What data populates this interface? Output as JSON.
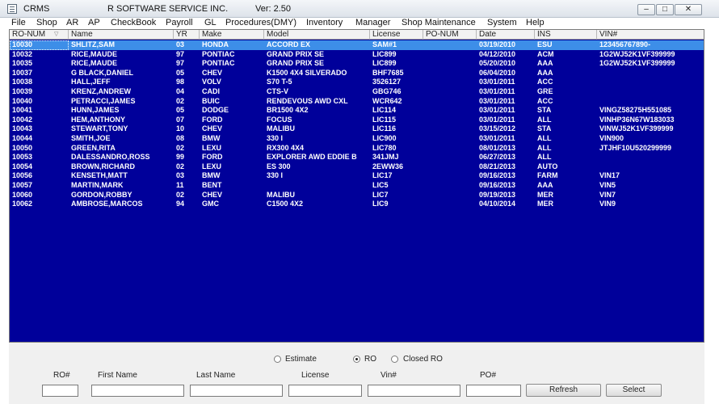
{
  "titlebar": {
    "app_name": "CRMS",
    "company": "R SOFTWARE SERVICE INC.",
    "version": "Ver: 2.50",
    "minimize": "–",
    "maximize": "□",
    "close": "✕"
  },
  "menu": [
    "File",
    "Shop",
    "AR",
    "AP",
    "CheckBook",
    "Payroll",
    "GL",
    "Procedures(DMY)",
    "Inventory",
    "Manager",
    "Shop Maintenance",
    "System",
    "Help"
  ],
  "grid": {
    "columns": [
      "RO-NUM",
      "Name",
      "YR",
      "Make",
      "Model",
      "License",
      "PO-NUM",
      "Date",
      "INS",
      "VIN#"
    ],
    "selected_index": 0,
    "rows": [
      [
        "10030",
        "SHLITZ,SAM",
        "03",
        "HONDA",
        "ACCORD EX",
        "SAM#1",
        "",
        "03/19/2010",
        "ESU",
        "123456767890-"
      ],
      [
        "10032",
        "RICE,MAUDE",
        "97",
        "PONTIAC",
        "GRAND PRIX SE",
        "LIC899",
        "",
        "04/12/2010",
        "ACM",
        "1G2WJ52K1VF399999"
      ],
      [
        "10035",
        "RICE,MAUDE",
        "97",
        "PONTIAC",
        "GRAND PRIX SE",
        "LIC899",
        "",
        "05/20/2010",
        "AAA",
        "1G2WJ52K1VF399999"
      ],
      [
        "10037",
        "G BLACK,DANIEL",
        "05",
        "CHEV",
        "K1500 4X4 SILVERADO",
        "BHF7685",
        "",
        "06/04/2010",
        "AAA",
        ""
      ],
      [
        "10038",
        "HALL,JEFF",
        "98",
        "VOLV",
        "S70 T-5",
        "3526127",
        "",
        "03/01/2011",
        "ACC",
        ""
      ],
      [
        "10039",
        "KRENZ,ANDREW",
        "04",
        "CADI",
        "CTS-V",
        "GBG746",
        "",
        "03/01/2011",
        "GRE",
        ""
      ],
      [
        "10040",
        "PETRACCI,JAMES",
        "02",
        "BUIC",
        "RENDEVOUS AWD CXL",
        "WCR642",
        "",
        "03/01/2011",
        "ACC",
        ""
      ],
      [
        "10041",
        "HUNN,JAMES",
        "05",
        "DODGE",
        "BR1500 4X2",
        "LIC114",
        "",
        "03/01/2011",
        "STA",
        "VINGZ58275H551085"
      ],
      [
        "10042",
        "HEM,ANTHONY",
        "07",
        "FORD",
        "FOCUS",
        "LIC115",
        "",
        "03/01/2011",
        "ALL",
        "VINHP36N67W183033"
      ],
      [
        "10043",
        "STEWART,TONY",
        "10",
        "CHEV",
        "MALIBU",
        "LIC116",
        "",
        "03/15/2012",
        "STA",
        "VINWJ52K1VF399999"
      ],
      [
        "10044",
        "SMITH,JOE",
        "08",
        "BMW",
        "330 I",
        "LIC900",
        "",
        "03/01/2011",
        "ALL",
        "VIN900"
      ],
      [
        "10050",
        "GREEN,RITA",
        "02",
        "LEXU",
        "RX300 4X4",
        "LIC780",
        "",
        "08/01/2013",
        "ALL",
        "JTJHF10U520299999"
      ],
      [
        "10053",
        "DALESSANDRO,ROSS",
        "99",
        "FORD",
        "EXPLORER AWD EDDIE B",
        "341JMJ",
        "",
        "06/27/2013",
        "ALL",
        ""
      ],
      [
        "10054",
        "BROWN,RICHARD",
        "02",
        "LEXU",
        "ES 300",
        "2EWW36",
        "",
        "08/21/2013",
        "AUTO",
        ""
      ],
      [
        "10056",
        "KENSETH,MATT",
        "03",
        "BMW",
        "330 I",
        "LIC17",
        "",
        "09/16/2013",
        "FARM",
        "VIN17"
      ],
      [
        "10057",
        "MARTIN,MARK",
        "11",
        "BENT",
        "",
        "LIC5",
        "",
        "09/16/2013",
        "AAA",
        "VIN5"
      ],
      [
        "10060",
        "GORDON,ROBBY",
        "02",
        "CHEV",
        "MALIBU",
        "LIC7",
        "",
        "09/19/2013",
        "MER",
        "VIN7"
      ],
      [
        "10062",
        "AMBROSE,MARCOS",
        "94",
        "GMC",
        "C1500 4X2",
        "LIC9",
        "",
        "04/10/2014",
        "MER",
        "VIN9"
      ]
    ]
  },
  "filter": {
    "radios": [
      {
        "label": "Estimate",
        "checked": false
      },
      {
        "label": "RO",
        "checked": true
      },
      {
        "label": "Closed RO",
        "checked": false
      }
    ],
    "fields": [
      {
        "label": "RO#",
        "value": ""
      },
      {
        "label": "First Name",
        "value": ""
      },
      {
        "label": "Last Name",
        "value": ""
      },
      {
        "label": "License",
        "value": ""
      },
      {
        "label": "Vin#",
        "value": ""
      },
      {
        "label": "PO#",
        "value": ""
      }
    ],
    "refresh_label": "Refresh",
    "select_label": "Select"
  }
}
